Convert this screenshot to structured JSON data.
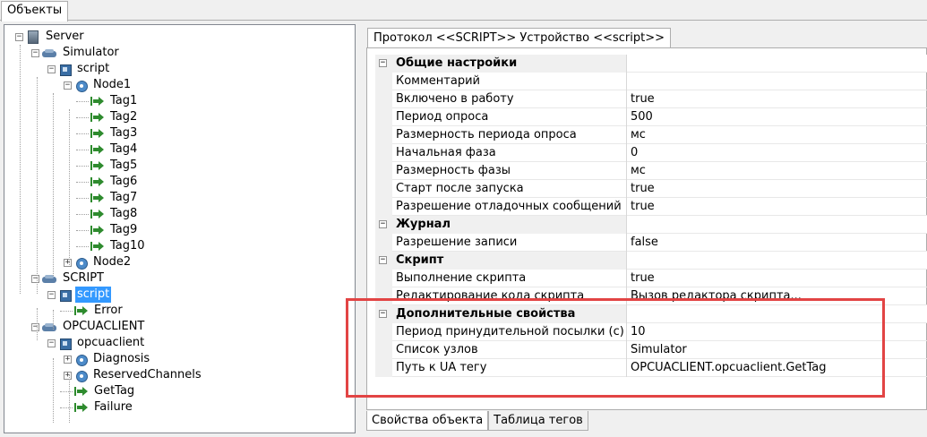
{
  "top_tab": "Объекты",
  "tree": [
    {
      "label": "Server",
      "icon": "server-icon",
      "expander": "−",
      "level": 0
    },
    {
      "label": "Simulator",
      "icon": "protocol-icon",
      "expander": "−",
      "level": 1
    },
    {
      "label": "script",
      "icon": "device-icon",
      "expander": "−",
      "level": 2
    },
    {
      "label": "Node1",
      "icon": "node-icon",
      "expander": "−",
      "level": 3
    },
    {
      "label": "Tag1",
      "icon": "tag-icon",
      "level": 4
    },
    {
      "label": "Tag2",
      "icon": "tag-icon",
      "level": 4
    },
    {
      "label": "Tag3",
      "icon": "tag-icon",
      "level": 4
    },
    {
      "label": "Tag4",
      "icon": "tag-icon",
      "level": 4
    },
    {
      "label": "Tag5",
      "icon": "tag-icon",
      "level": 4
    },
    {
      "label": "Tag6",
      "icon": "tag-icon",
      "level": 4
    },
    {
      "label": "Tag7",
      "icon": "tag-icon",
      "level": 4
    },
    {
      "label": "Tag8",
      "icon": "tag-icon",
      "level": 4
    },
    {
      "label": "Tag9",
      "icon": "tag-icon",
      "level": 4
    },
    {
      "label": "Tag10",
      "icon": "tag-icon",
      "level": 4
    },
    {
      "label": "Node2",
      "icon": "node-icon",
      "expander": "+",
      "level": 3
    },
    {
      "label": "SCRIPT",
      "icon": "protocol-icon",
      "expander": "−",
      "level": 1
    },
    {
      "label": "script",
      "icon": "device-icon",
      "expander": "−",
      "level": 2,
      "selected": true
    },
    {
      "label": "Error",
      "icon": "tag-icon",
      "level": 3
    },
    {
      "label": "OPCUACLIENT",
      "icon": "protocol-icon",
      "expander": "−",
      "level": 1
    },
    {
      "label": "opcuaclient",
      "icon": "device-icon",
      "expander": "−",
      "level": 2
    },
    {
      "label": "Diagnosis",
      "icon": "node-icon",
      "expander": "+",
      "level": 3
    },
    {
      "label": "ReservedChannels",
      "icon": "node-icon",
      "expander": "+",
      "level": 3
    },
    {
      "label": "GetTag",
      "icon": "tag-icon",
      "level": 3
    },
    {
      "label": "Failure",
      "icon": "tag-icon",
      "level": 3
    }
  ],
  "props_tab": "Протокол <<SCRIPT>> Устройство <<script>>",
  "grid": [
    {
      "category": true,
      "name": "Общие настройки",
      "value": ""
    },
    {
      "name": "Комментарий",
      "value": ""
    },
    {
      "name": "Включено в работу",
      "value": "true"
    },
    {
      "name": "Период опроса",
      "value": "500"
    },
    {
      "name": "Размерность периода опроса",
      "value": "мс"
    },
    {
      "name": "Начальная фаза",
      "value": "0"
    },
    {
      "name": "Размерность фазы",
      "value": "мс"
    },
    {
      "name": "Старт после запуска",
      "value": "true"
    },
    {
      "name": "Разрешение отладочных сообщений",
      "value": "true"
    },
    {
      "category": true,
      "name": "Журнал",
      "value": ""
    },
    {
      "name": "Разрешение записи",
      "value": "false"
    },
    {
      "category": true,
      "name": "Скрипт",
      "value": ""
    },
    {
      "name": "Выполнение скрипта",
      "value": "true"
    },
    {
      "name": "Редактирование кода скрипта",
      "value": "Вызов редактора скрипта..."
    },
    {
      "category": true,
      "name": "Дополнительные свойства",
      "value": ""
    },
    {
      "name": "Период принудительной посылки (с)",
      "value": "10"
    },
    {
      "name": "Список узлов",
      "value": "Simulator"
    },
    {
      "name": "Путь к UA тегу",
      "value": "OPCUACLIENT.opcuaclient.GetTag"
    }
  ],
  "bottom_tabs": [
    "Свойства объекта",
    "Таблица тегов"
  ],
  "colors": {
    "selection": "#3399ff",
    "highlight": "#e24444",
    "tag_arrow": "#2e8b2e"
  }
}
